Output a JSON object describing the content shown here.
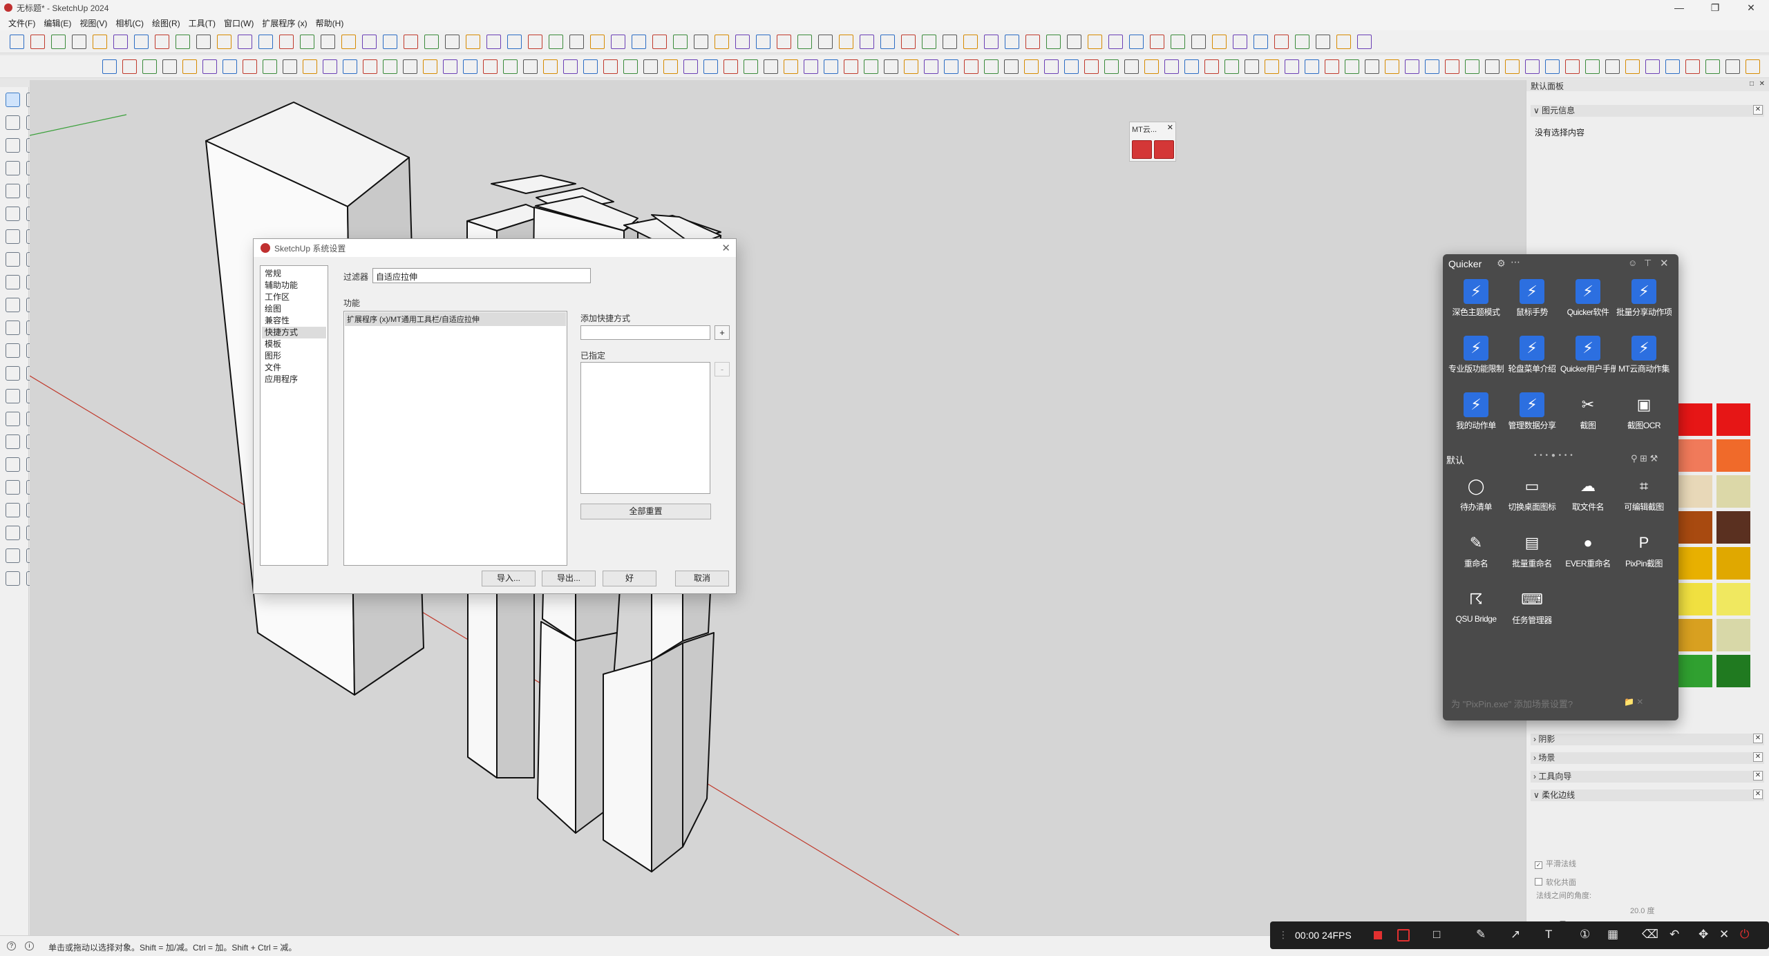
{
  "app": {
    "title": "无标题* - SketchUp 2024"
  },
  "menu": [
    "文件(F)",
    "编辑(E)",
    "视图(V)",
    "相机(C)",
    "绘图(R)",
    "工具(T)",
    "窗口(W)",
    "扩展程序 (x)",
    "帮助(H)"
  ],
  "mt_panel": {
    "title": "MT云..."
  },
  "dialog": {
    "title": "SketchUp 系统设置",
    "categories": [
      "常规",
      "辅助功能",
      "工作区",
      "绘图",
      "兼容性",
      "快捷方式",
      "模板",
      "图形",
      "文件",
      "应用程序"
    ],
    "selected_category": "快捷方式",
    "filter_label": "过滤器",
    "filter_value": "自适应拉伸",
    "function_label": "功能",
    "function_item": "扩展程序 (x)/MT通用工具栏/自适应拉伸",
    "add_shortcut_label": "添加快捷方式",
    "add_button": "+",
    "assigned_label": "已指定",
    "remove_button": "-",
    "reset_all": "全部重置",
    "import": "导入...",
    "export": "导出...",
    "ok": "好",
    "cancel": "取消"
  },
  "tray": {
    "title": "默认面板",
    "entity_info": "图元信息",
    "no_selection": "没有选择内容",
    "sections": [
      "阴影",
      "场景",
      "工具向导",
      "柔化边线"
    ],
    "smooth_angle_label": "法线之间的角度:",
    "smooth_angle_value": "20.0 度",
    "smooth_normals": "平滑法线",
    "soften_coplanar": "软化共面",
    "smooth_normals_checked": true,
    "soften_coplanar_checked": false,
    "swatch_colors": [
      "#e61616",
      "#e61616",
      "#f07a5a",
      "#f06a2a",
      "#e8d8b8",
      "#dcd8a8",
      "#a84a10",
      "#5a3020",
      "#e8b000",
      "#e0a800",
      "#f0e040",
      "#f0e860",
      "#d8a020",
      "#d8d8a8",
      "#30a030",
      "#207a20"
    ]
  },
  "quicker": {
    "title": "Quicker",
    "group_label": "默认",
    "top_actions": [
      {
        "label": "深色主题模式",
        "icon": "lightning"
      },
      {
        "label": "鼠标手势",
        "icon": "lightning"
      },
      {
        "label": "Quicker软件",
        "icon": "lightning"
      },
      {
        "label": "批量分享动作项",
        "icon": "lightning"
      },
      {
        "label": "专业版功能限制",
        "icon": "lightning"
      },
      {
        "label": "轮盘菜单介绍",
        "icon": "lightning"
      },
      {
        "label": "Quicker用户手册",
        "icon": "lightning"
      },
      {
        "label": "MT云商动作集",
        "icon": "lightning"
      },
      {
        "label": "我的动作单",
        "icon": "lightning"
      },
      {
        "label": "管理数据分享",
        "icon": "lightning"
      },
      {
        "label": "截图",
        "icon": "scissors"
      },
      {
        "label": "截图OCR",
        "icon": "ocr"
      }
    ],
    "bottom_actions": [
      {
        "label": "待办清单",
        "icon": "circle"
      },
      {
        "label": "切换桌面图标",
        "icon": "monitor"
      },
      {
        "label": "取文件名",
        "icon": "cloud"
      },
      {
        "label": "可编辑截图",
        "icon": "crop"
      },
      {
        "label": "重命名",
        "icon": "pencil"
      },
      {
        "label": "批量重命名",
        "icon": "files"
      },
      {
        "label": "EVER重命名",
        "icon": "ever"
      },
      {
        "label": "PixPin截图",
        "icon": "pixpin"
      },
      {
        "label": "QSU Bridge",
        "icon": "wifi"
      },
      {
        "label": "任务管理器",
        "icon": "keyboard"
      }
    ],
    "footer": "为 \"PixPin.exe\" 添加场景设置?"
  },
  "status": {
    "text": "单击或拖动以选择对象。Shift = 加/减。Ctrl = 加。Shift + Ctrl = 减。"
  },
  "recorder": {
    "time": "00:00",
    "fps": "24FPS"
  }
}
